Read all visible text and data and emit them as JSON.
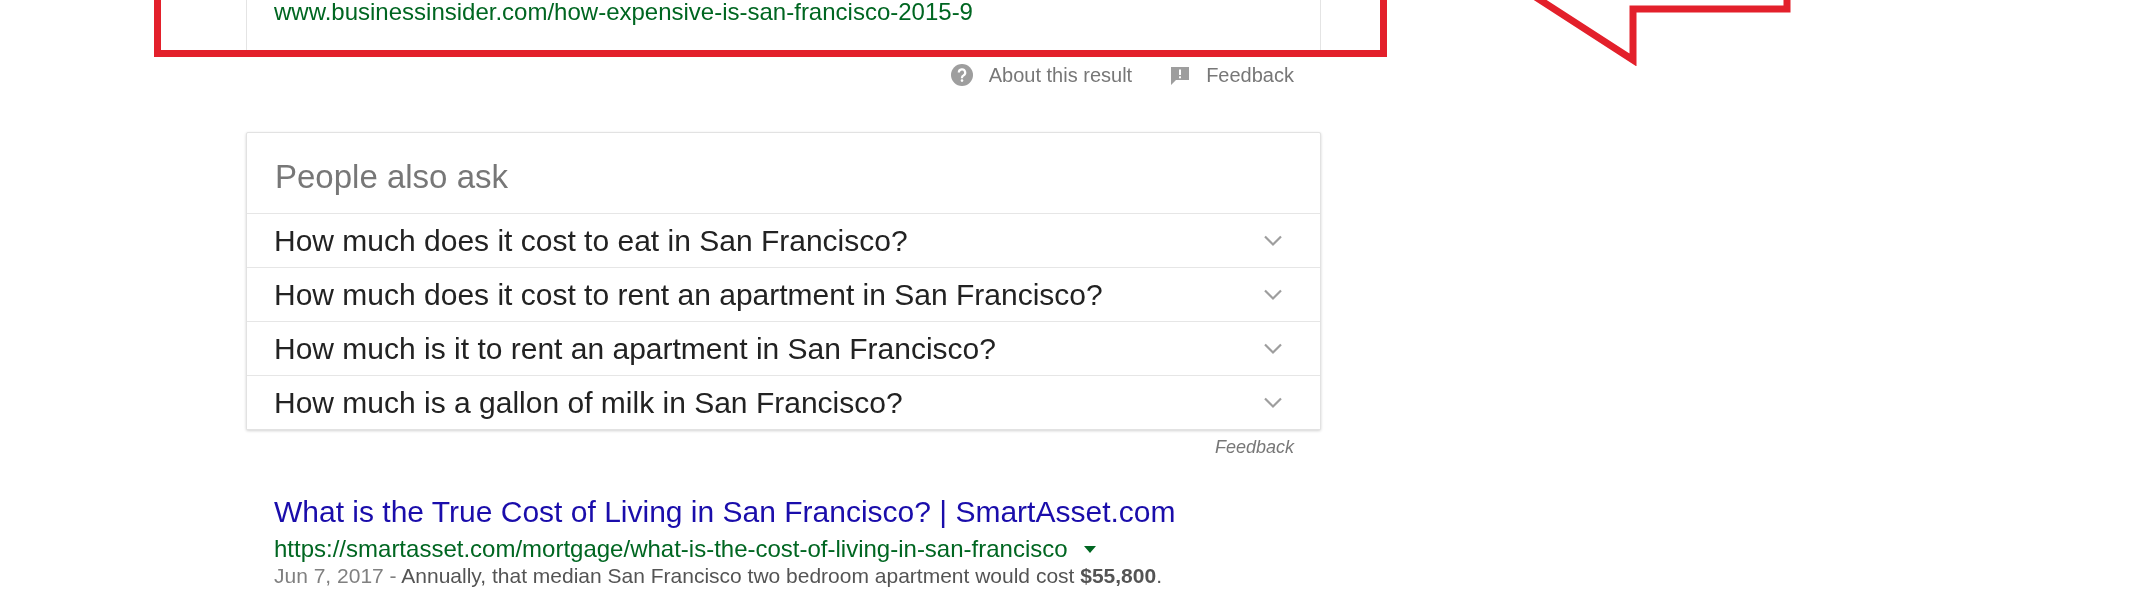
{
  "top_result": {
    "url": "www.businessinsider.com/how-expensive-is-san-francisco-2015-9"
  },
  "result_links": [
    {
      "kind": "help",
      "label": "About this result"
    },
    {
      "kind": "feedback",
      "label": "Feedback"
    }
  ],
  "people_also_ask": {
    "title": "People also ask",
    "questions": [
      {
        "text": "How much does it cost to eat in San Francisco?",
        "expanded": false
      },
      {
        "text": "How much does it cost to rent an apartment in San Francisco?",
        "expanded": false
      },
      {
        "text": "How much is it to rent an apartment in San Francisco?",
        "expanded": false
      },
      {
        "text": "How much is a gallon of milk in San Francisco?",
        "expanded": false
      }
    ],
    "feedback": "Feedback"
  },
  "results": [
    {
      "title": "What is the True Cost of Living in San Francisco? | SmartAsset.com",
      "url": "https://smartasset.com/mortgage/what-is-the-cost-of-living-in-san-francisco",
      "date": "Jun 7, 2017 -",
      "snippet": "Annually, that median San Francisco two bedroom apartment would cost **$55,800**."
    }
  ]
}
